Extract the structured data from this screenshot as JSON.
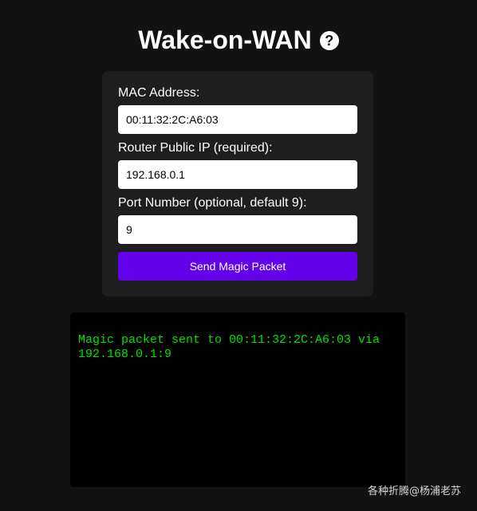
{
  "header": {
    "title": "Wake-on-WAN",
    "help_glyph": "?"
  },
  "form": {
    "mac": {
      "label": "MAC Address:",
      "value": "00:11:32:2C:A6:03"
    },
    "ip": {
      "label": "Router Public IP (required):",
      "value": "192.168.0.1"
    },
    "port": {
      "label": "Port Number (optional, default 9):",
      "value": "9"
    },
    "submit_label": "Send Magic Packet"
  },
  "output": {
    "text": "Magic packet sent to 00:11:32:2C:A6:03 via 192.168.0.1:9"
  },
  "watermark": {
    "text": "各种折腾@杨浦老苏"
  },
  "colors": {
    "background": "#121212",
    "card": "#1e1e1e",
    "accent": "#6200ea",
    "terminal_text": "#00e000"
  }
}
